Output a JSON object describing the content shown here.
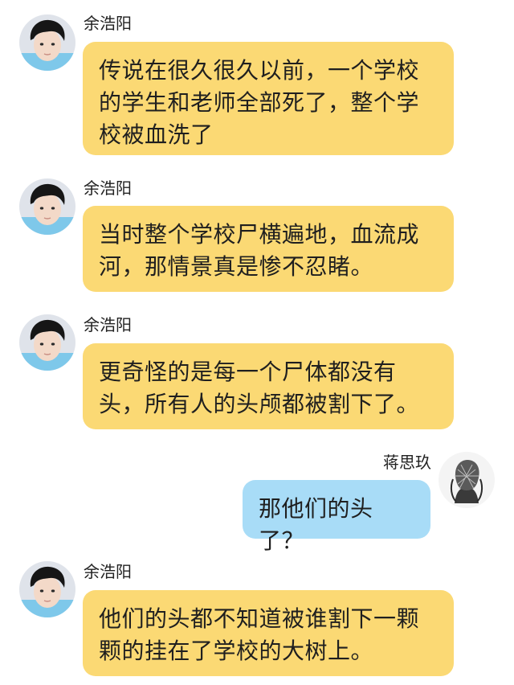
{
  "colors": {
    "incoming_bubble": "#fbd974",
    "outgoing_bubble": "#a8dcf7",
    "background": "#ffffff"
  },
  "messages": [
    {
      "sender": "余浩阳",
      "side": "left",
      "avatar": "boy-photo-avatar",
      "text": "传说在很久很久以前，一个学校的学生和老师全部死了，整个学校被血洗了"
    },
    {
      "sender": "余浩阳",
      "side": "left",
      "avatar": "boy-photo-avatar",
      "text": "当时整个学校尸横遍地，血流成河，那情景真是惨不忍睹。"
    },
    {
      "sender": "余浩阳",
      "side": "left",
      "avatar": "boy-photo-avatar",
      "text": "更奇怪的是每一个尸体都没有头，所有人的头颅都被割下了。"
    },
    {
      "sender": "蒋思玖",
      "side": "right",
      "avatar": "sketch-portrait-avatar",
      "text": "那他们的头了？"
    },
    {
      "sender": "余浩阳",
      "side": "left",
      "avatar": "boy-photo-avatar",
      "text": "他们的头都不知道被谁割下一颗颗的挂在了学校的大树上。"
    }
  ]
}
